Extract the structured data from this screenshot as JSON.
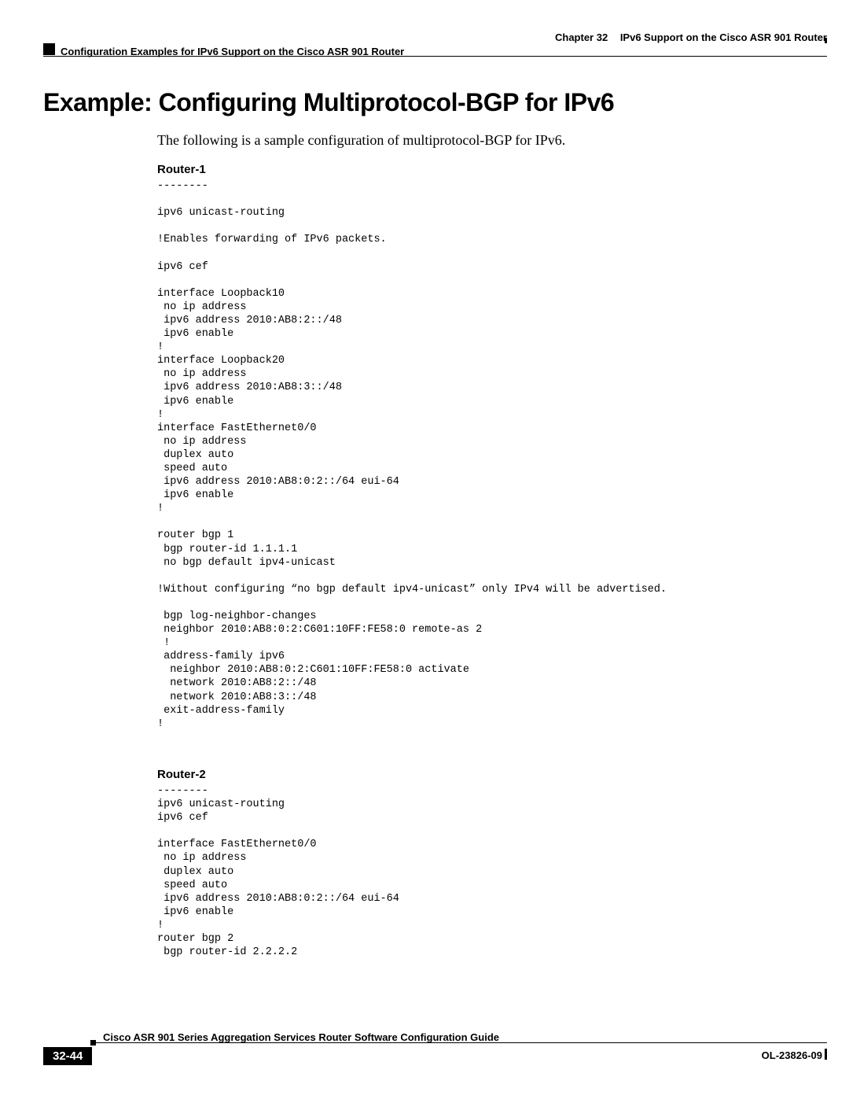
{
  "header": {
    "chapter": "Chapter 32",
    "chapter_title": "IPv6 Support on the Cisco ASR 901 Router",
    "subhead": "Configuration Examples for IPv6 Support on the Cisco ASR 901 Router"
  },
  "title": "Example: Configuring Multiprotocol-BGP for IPv6",
  "intro": "The following is a sample configuration of multiprotocol-BGP for IPv6.",
  "section1_label": "Router-1",
  "code1": "--------\n\nipv6 unicast-routing\n\n!Enables forwarding of IPv6 packets.\n\nipv6 cef\n\ninterface Loopback10\n no ip address\n ipv6 address 2010:AB8:2::/48\n ipv6 enable\n!\ninterface Loopback20\n no ip address\n ipv6 address 2010:AB8:3::/48\n ipv6 enable\n!\ninterface FastEthernet0/0\n no ip address\n duplex auto\n speed auto\n ipv6 address 2010:AB8:0:2::/64 eui-64\n ipv6 enable\n!\n\nrouter bgp 1\n bgp router-id 1.1.1.1\n no bgp default ipv4-unicast\n\n!Without configuring “no bgp default ipv4-unicast” only IPv4 will be advertised.\n\n bgp log-neighbor-changes\n neighbor 2010:AB8:0:2:C601:10FF:FE58:0 remote-as 2\n !\n address-family ipv6\n  neighbor 2010:AB8:0:2:C601:10FF:FE58:0 activate\n  network 2010:AB8:2::/48\n  network 2010:AB8:3::/48\n exit-address-family\n!",
  "section2_label": "Router-2",
  "code2": "--------\nipv6 unicast-routing\nipv6 cef\n\ninterface FastEthernet0/0\n no ip address\n duplex auto\n speed auto\n ipv6 address 2010:AB8:0:2::/64 eui-64\n ipv6 enable\n!\nrouter bgp 2\n bgp router-id 2.2.2.2",
  "footer": {
    "guide": "Cisco ASR 901 Series Aggregation Services Router Software Configuration Guide",
    "page": "32-44",
    "doc_id": "OL-23826-09"
  }
}
